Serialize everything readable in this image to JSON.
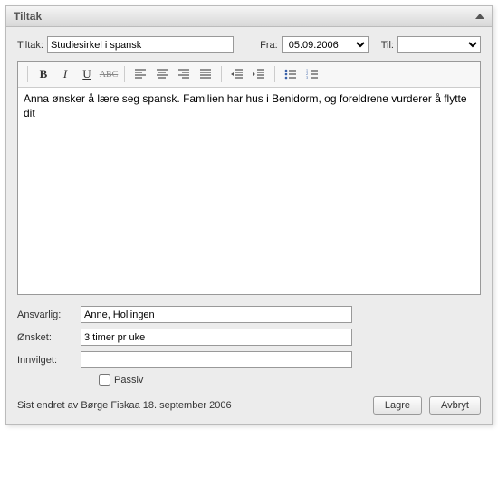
{
  "header": {
    "title": "Tiltak"
  },
  "top": {
    "tiltak_label": "Tiltak:",
    "tiltak_value": "Studiesirkel i spansk",
    "fra_label": "Fra:",
    "fra_value": "05.09.2006",
    "til_label": "Til:",
    "til_value": ""
  },
  "editor": {
    "content": "Anna ønsker å lære seg spansk. Familien har hus i Benidorm, og foreldrene vurderer å flytte dit"
  },
  "fields": {
    "ansvarlig_label": "Ansvarlig:",
    "ansvarlig_value": "Anne, Hollingen",
    "onsket_label": "Ønsket:",
    "onsket_value": "3 timer pr uke",
    "innvilget_label": "Innvilget:",
    "innvilget_value": "",
    "passiv_label": "Passiv"
  },
  "footer": {
    "lastmodified": "Sist endret av Børge Fiskaa 18. september 2006",
    "save": "Lagre",
    "cancel": "Avbryt"
  }
}
